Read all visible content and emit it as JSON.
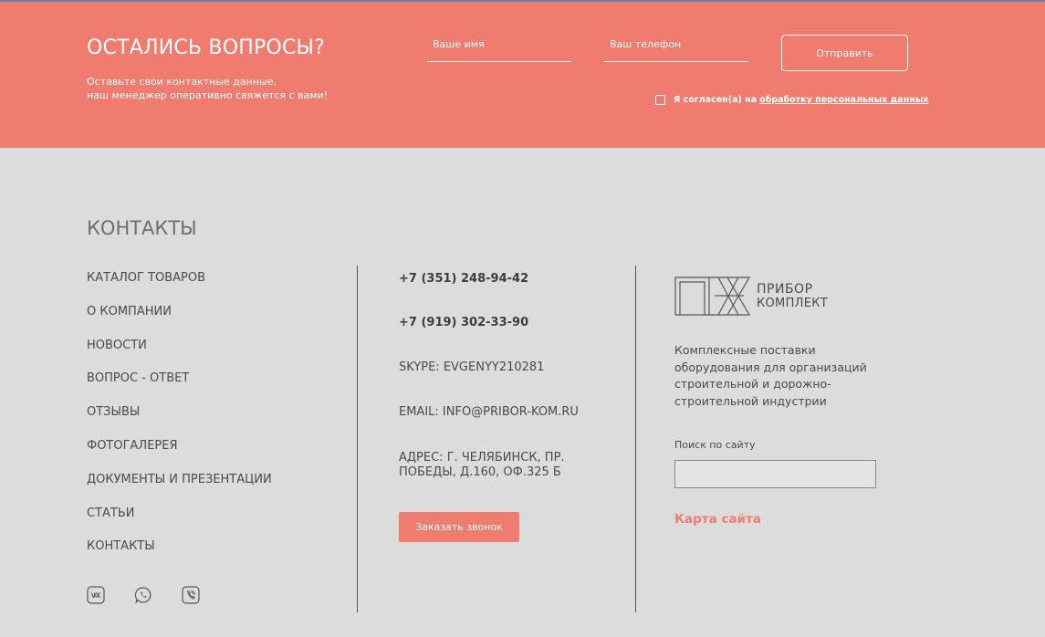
{
  "feedback": {
    "title": "ОСТАЛИСЬ ВОПРОСЫ?",
    "subtitle_line1": "Оставьте свои контактные данные,",
    "subtitle_line2": "наш менеджер оперативно свяжется с вами!",
    "name_placeholder": "Ваше имя",
    "name_value": "",
    "phone_placeholder": "Ваш телефон",
    "phone_value": "",
    "submit_label": "Отправить",
    "consent_text": "Я согласен(а) на",
    "consent_link": "обработку персональных данных",
    "consent_checked": false,
    "accent_color": "#f07c70"
  },
  "footer": {
    "title": "КОНТАКТЫ",
    "nav": [
      {
        "label": "КАТАЛОГ ТОВАРОВ"
      },
      {
        "label": "О КОМПАНИИ"
      },
      {
        "label": "НОВОСТИ"
      },
      {
        "label": "ВОПРОС - ОТВЕТ"
      },
      {
        "label": "ОТЗЫВЫ"
      },
      {
        "label": "ФОТОГАЛЕРЕЯ"
      },
      {
        "label": "ДОКУМЕНТЫ И ПРЕЗЕНТАЦИИ"
      },
      {
        "label": "СТАТЬИ"
      },
      {
        "label": "КОНТАКТЫ"
      }
    ],
    "socials": [
      {
        "icon": "vk-icon"
      },
      {
        "icon": "whatsapp-icon"
      },
      {
        "icon": "viber-icon"
      }
    ],
    "contacts": {
      "phone1": "+7 (351) 248-94-42",
      "phone2": "+7 (919) 302-33-90",
      "skype": "SKYPE: EVGENYY210281",
      "email": "EMAIL: INFO@PRIBOR-KOM.RU",
      "address_line1": "АДРЕС: Г. ЧЕЛЯБИНСК, ПР.",
      "address_line2": "ПОБЕДЫ, Д.160, ОФ.325 Б",
      "call_button": "Заказать звонок"
    },
    "brand": {
      "name_line1": "ПРИБОР",
      "name_line2": "КОМПЛЕКТ",
      "description_line1": "Комплексные поставки",
      "description_line2": "оборудования для организаций",
      "description_line3": "строительной и дорожно-",
      "description_line4": "строительной индустрии",
      "search_label": "Поиск по сайту",
      "search_value": "",
      "sitemap_link": "Карта сайта"
    }
  }
}
